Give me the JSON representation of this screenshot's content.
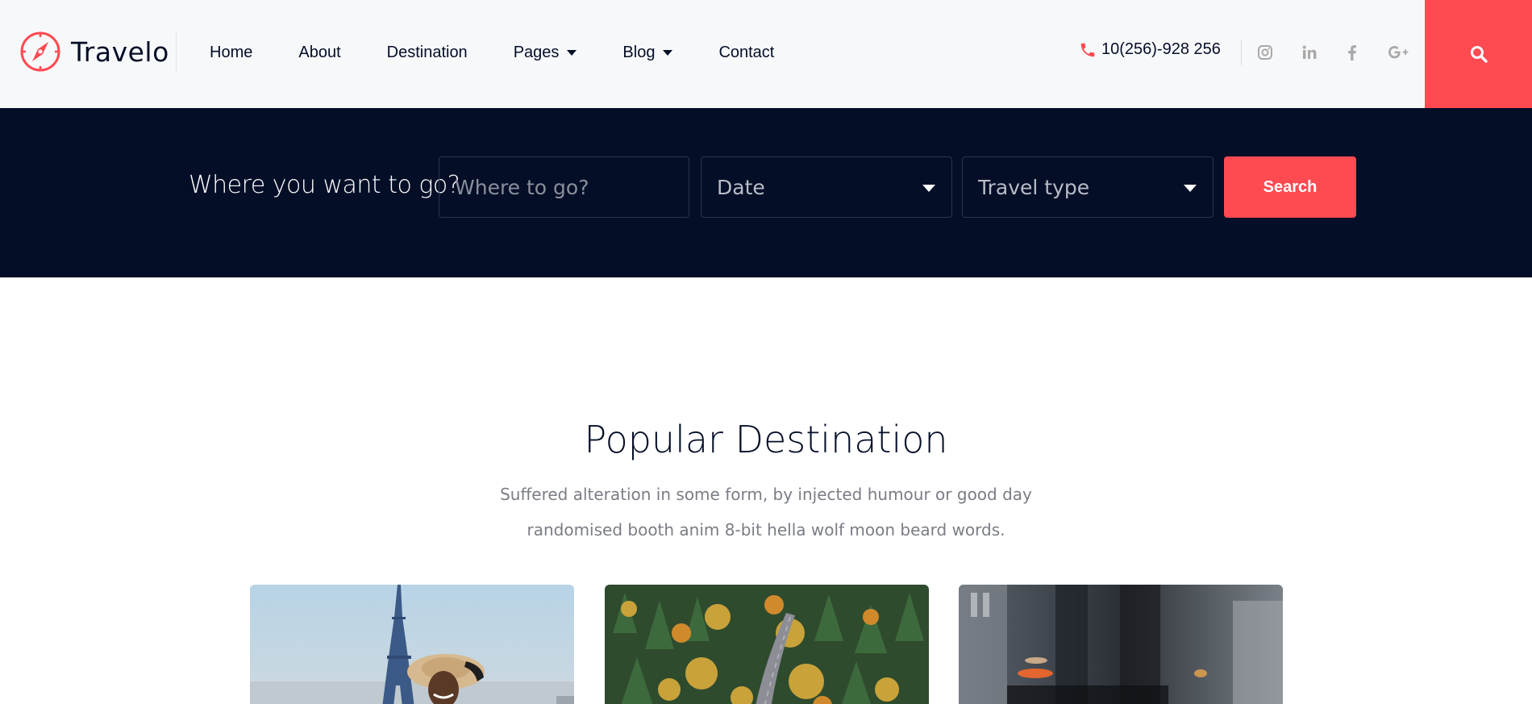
{
  "brand": {
    "name": "Travelo",
    "accent": "#ff4a52",
    "dark": "#040e27"
  },
  "nav": {
    "items": [
      {
        "label": "Home",
        "has_dropdown": false
      },
      {
        "label": "About",
        "has_dropdown": false
      },
      {
        "label": "Destination",
        "has_dropdown": false
      },
      {
        "label": "Pages",
        "has_dropdown": true
      },
      {
        "label": "Blog",
        "has_dropdown": true
      },
      {
        "label": "Contact",
        "has_dropdown": false
      }
    ]
  },
  "contact": {
    "phone": "10(256)-928 256",
    "icon": "phone-icon"
  },
  "social": [
    "instagram-icon",
    "linkedin-icon",
    "facebook-icon",
    "google-plus-icon"
  ],
  "search_bar": {
    "label": "Where you want to go?",
    "where_placeholder": "Where to go?",
    "date_value": "Date",
    "travel_type_value": "Travel type",
    "button_label": "Search"
  },
  "popular": {
    "title": "Popular Destination",
    "subtitle_line1": "Suffered alteration in some form, by injected humour or good day",
    "subtitle_line2": "randomised booth anim 8-bit hella wolf moon beard words."
  }
}
